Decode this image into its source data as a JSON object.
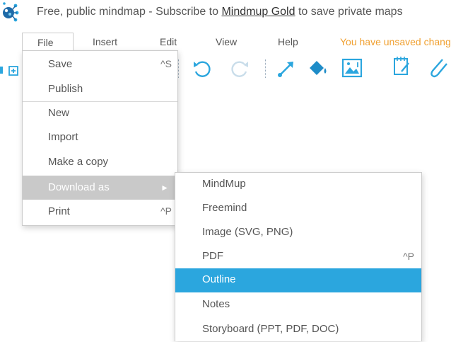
{
  "banner": {
    "prefix": "Free, public mindmap - Subscribe to ",
    "link": "Mindmup Gold",
    "suffix": " to save private maps"
  },
  "menubar": {
    "items": [
      "File",
      "Insert",
      "Edit",
      "View",
      "Help"
    ],
    "unsaved": "You have unsaved changes"
  },
  "file_menu": {
    "items": [
      {
        "label": "Save",
        "shortcut": "^S"
      },
      {
        "label": "Publish",
        "shortcut": ""
      },
      {
        "label": "New",
        "shortcut": ""
      },
      {
        "label": "Import",
        "shortcut": ""
      },
      {
        "label": "Make a copy",
        "shortcut": ""
      },
      {
        "label": "Download as",
        "shortcut": "►"
      },
      {
        "label": "Print",
        "shortcut": "^P"
      }
    ]
  },
  "download_menu": {
    "items": [
      {
        "label": "MindMup",
        "shortcut": ""
      },
      {
        "label": "Freemind",
        "shortcut": ""
      },
      {
        "label": "Image (SVG, PNG)",
        "shortcut": ""
      },
      {
        "label": "PDF",
        "shortcut": "^P"
      },
      {
        "label": "Outline",
        "shortcut": ""
      },
      {
        "label": "Notes",
        "shortcut": ""
      },
      {
        "label": "Storyboard (PPT, PDF, DOC)",
        "shortcut": ""
      }
    ],
    "selected": "Outline"
  },
  "colors": {
    "accent_blue": "#2ba6de",
    "unsaved_orange": "#f0a030",
    "active_gray": "#c9c9c9"
  },
  "toolbar_icons": [
    "expand-icon",
    "add-node-icon",
    "undo-icon",
    "redo-icon",
    "connector-icon",
    "paint-bucket-icon",
    "image-icon",
    "notes-icon",
    "attachment-icon"
  ]
}
